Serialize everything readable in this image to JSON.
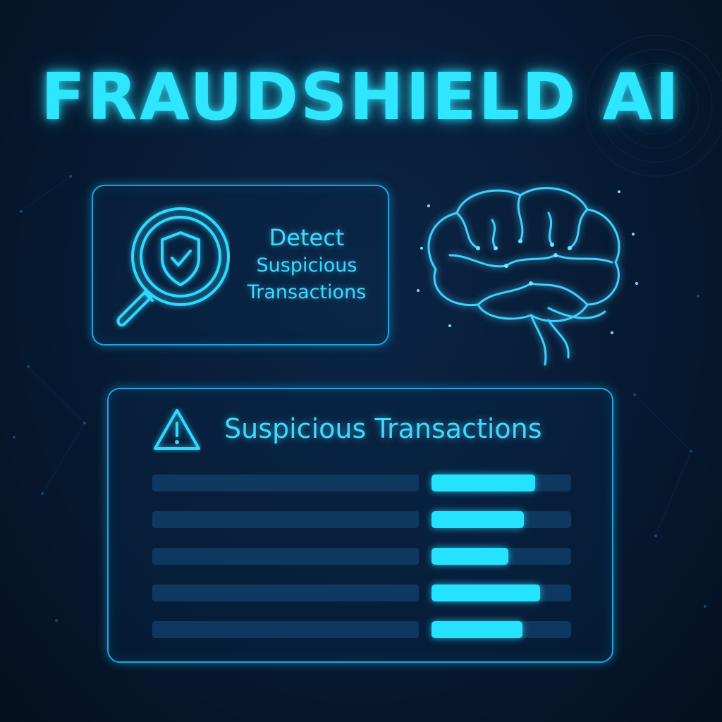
{
  "title": "FRAUDSHIELD AI",
  "detect_card": {
    "line1": "Detect",
    "line2": "Suspicious",
    "line3": "Transactions",
    "icon": "shield-check-magnifier-icon"
  },
  "brain_icon": "brain-circuit-icon",
  "transactions": {
    "title": "Suspicious Transactions",
    "icon": "warning-icon",
    "risk_levels": [
      0.74,
      0.66,
      0.55,
      0.78,
      0.65
    ]
  },
  "colors": {
    "accent": "#2ee6ff",
    "border": "#1aa6e0",
    "bar_track": "#0f3860",
    "background": "#071a33"
  }
}
